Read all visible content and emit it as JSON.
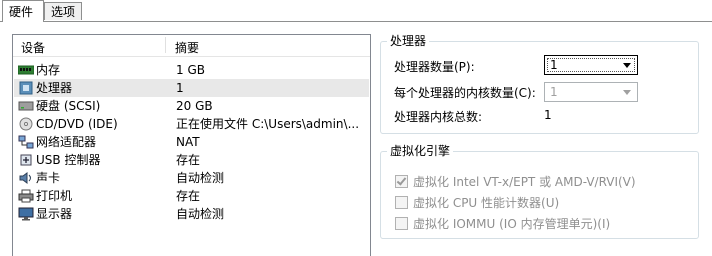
{
  "tabs": [
    {
      "label": "硬件",
      "active": true
    },
    {
      "label": "选项",
      "active": false
    }
  ],
  "device_list": {
    "col_device": "设备",
    "col_summary": "摘要",
    "rows": [
      {
        "name": "内存",
        "summary": "1 GB",
        "icon": "memory-icon",
        "selected": false
      },
      {
        "name": "处理器",
        "summary": "1",
        "icon": "processor-icon",
        "selected": true
      },
      {
        "name": "硬盘 (SCSI)",
        "summary": "20 GB",
        "icon": "hard-disk-icon",
        "selected": false
      },
      {
        "name": "CD/DVD (IDE)",
        "summary": "正在使用文件 C:\\Users\\admin\\...",
        "icon": "cd-dvd-icon",
        "selected": false
      },
      {
        "name": "网络适配器",
        "summary": "NAT",
        "icon": "network-adapter-icon",
        "selected": false
      },
      {
        "name": "USB 控制器",
        "summary": "存在",
        "icon": "usb-icon",
        "selected": false
      },
      {
        "name": "声卡",
        "summary": "自动检测",
        "icon": "sound-card-icon",
        "selected": false
      },
      {
        "name": "打印机",
        "summary": "存在",
        "icon": "printer-icon",
        "selected": false
      },
      {
        "name": "显示器",
        "summary": "自动检测",
        "icon": "display-icon",
        "selected": false
      }
    ]
  },
  "processor": {
    "group_title": "处理器",
    "count_label": "处理器数量(P):",
    "count_value": "1",
    "cores_label": "每个处理器的内核数量(C):",
    "cores_value": "1",
    "total_label": "处理器内核总数:",
    "total_value": "1"
  },
  "virtualization": {
    "group_title": "虚拟化引擎",
    "options": [
      {
        "label": "虚拟化 Intel VT-x/EPT 或 AMD-V/RVI(V)",
        "checked": true
      },
      {
        "label": "虚拟化 CPU 性能计数器(U)",
        "checked": false
      },
      {
        "label": "虚拟化 IOMMU (IO 内存管理单元)(I)",
        "checked": false
      }
    ]
  }
}
